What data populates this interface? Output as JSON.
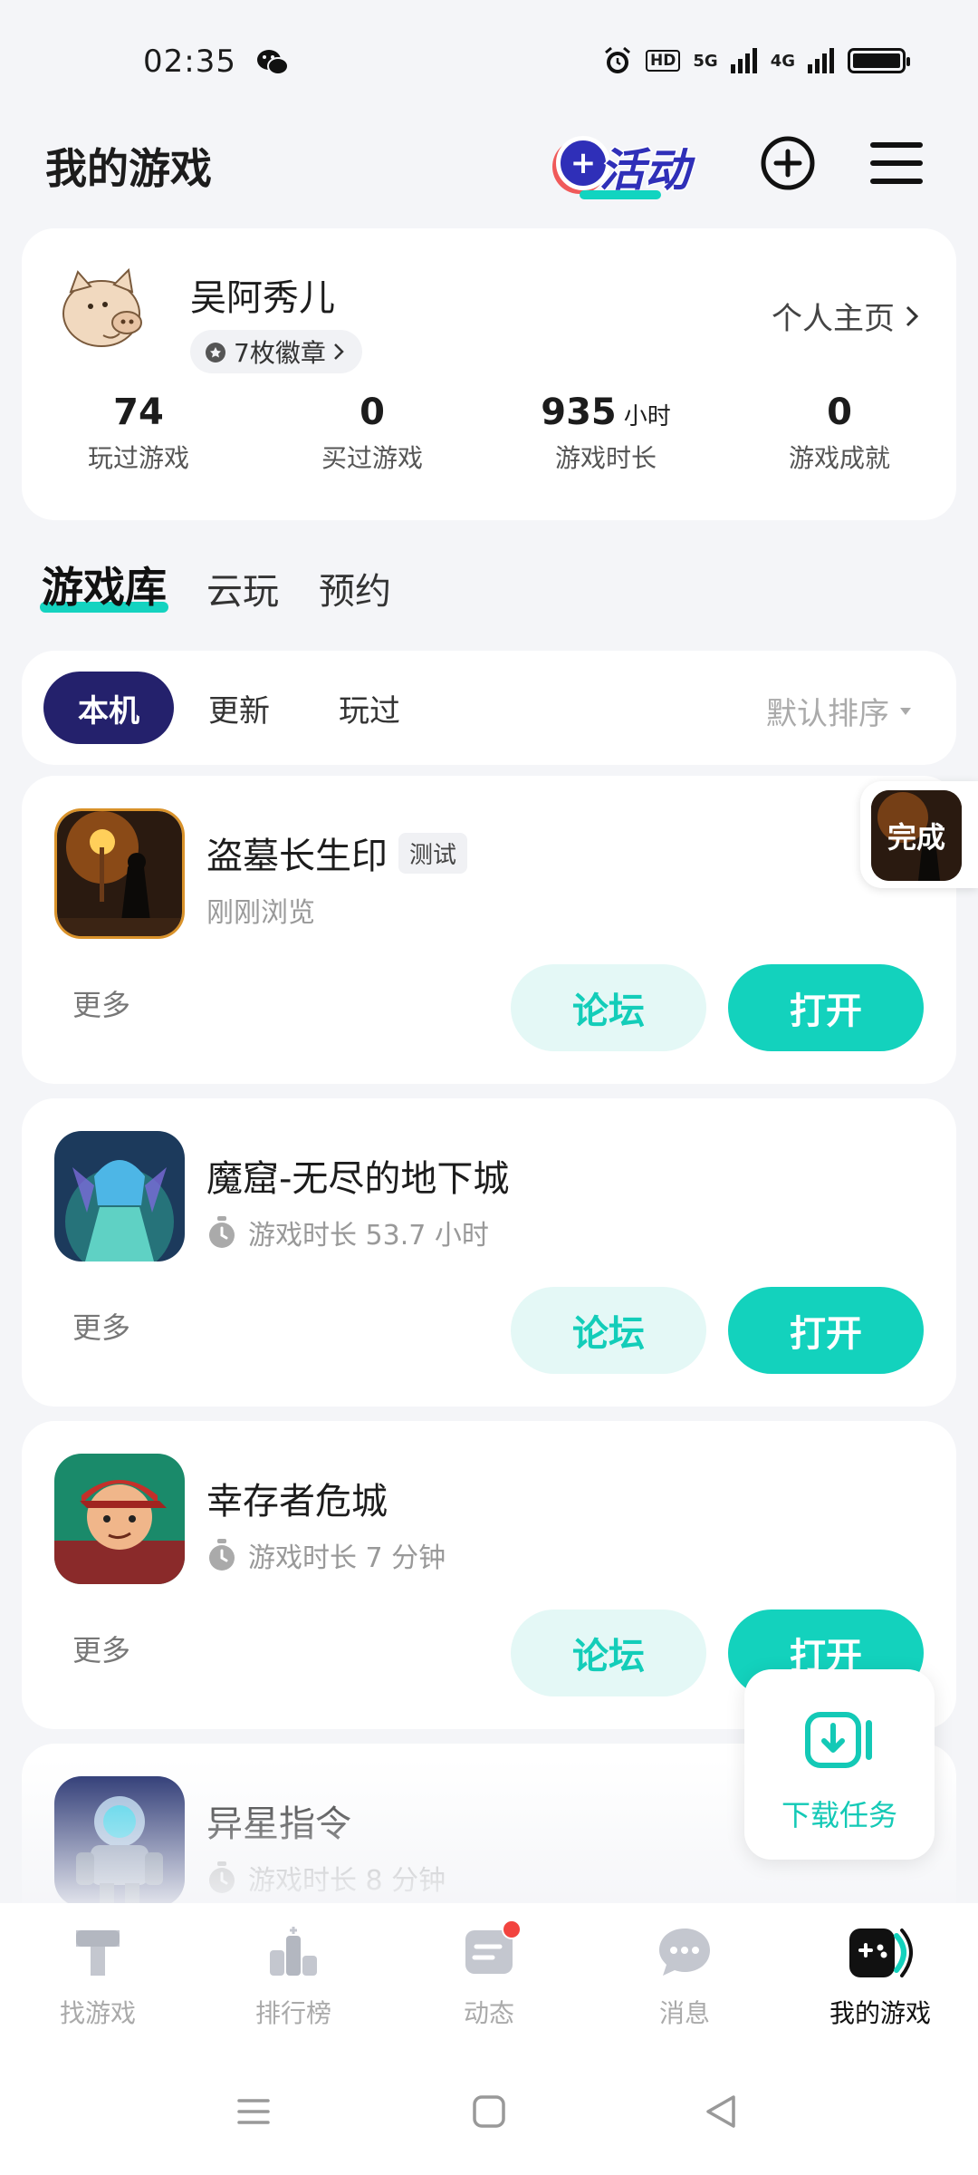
{
  "status_bar": {
    "time": "02:35",
    "hd_label": "HD",
    "net1": "5G",
    "net2": "4G"
  },
  "header": {
    "title": "我的游戏",
    "activity_label": "活动"
  },
  "profile": {
    "username": "吴阿秀儿",
    "medals": "7枚徽章",
    "homepage_label": "个人主页",
    "stats": [
      {
        "value": "74",
        "unit": "",
        "label": "玩过游戏"
      },
      {
        "value": "0",
        "unit": "",
        "label": "买过游戏"
      },
      {
        "value": "935",
        "unit": "小时",
        "label": "游戏时长"
      },
      {
        "value": "0",
        "unit": "",
        "label": "游戏成就"
      }
    ]
  },
  "tabs": [
    "游戏库",
    "云玩",
    "预约"
  ],
  "filters": [
    "本机",
    "更新",
    "玩过"
  ],
  "sort_label": "默认排序",
  "games": [
    {
      "name": "盗墓长生印",
      "tag": "测试",
      "sub": "刚刚浏览",
      "more": "更多",
      "forum": "论坛",
      "open": "打开"
    },
    {
      "name": "魔窟-无尽的地下城",
      "tag": "",
      "sub": "游戏时长 53.7 小时",
      "more": "更多",
      "forum": "论坛",
      "open": "打开"
    },
    {
      "name": "幸存者危城",
      "tag": "",
      "sub": "游戏时长 7 分钟",
      "more": "更多",
      "forum": "论坛",
      "open": "打开"
    },
    {
      "name": "异星指令",
      "tag": "",
      "sub": "游戏时长 8 分钟"
    }
  ],
  "float_done": "完成",
  "download_task": "下载任务",
  "bottom_nav": [
    {
      "label": "找游戏",
      "icon": "find-game-icon"
    },
    {
      "label": "排行榜",
      "icon": "ranking-icon"
    },
    {
      "label": "动态",
      "icon": "feed-icon"
    },
    {
      "label": "消息",
      "icon": "message-icon"
    },
    {
      "label": "我的游戏",
      "icon": "my-games-icon"
    }
  ],
  "colors": {
    "accent": "#13d2bd",
    "primary_dark": "#24216c",
    "badge_red": "#f2443f"
  }
}
